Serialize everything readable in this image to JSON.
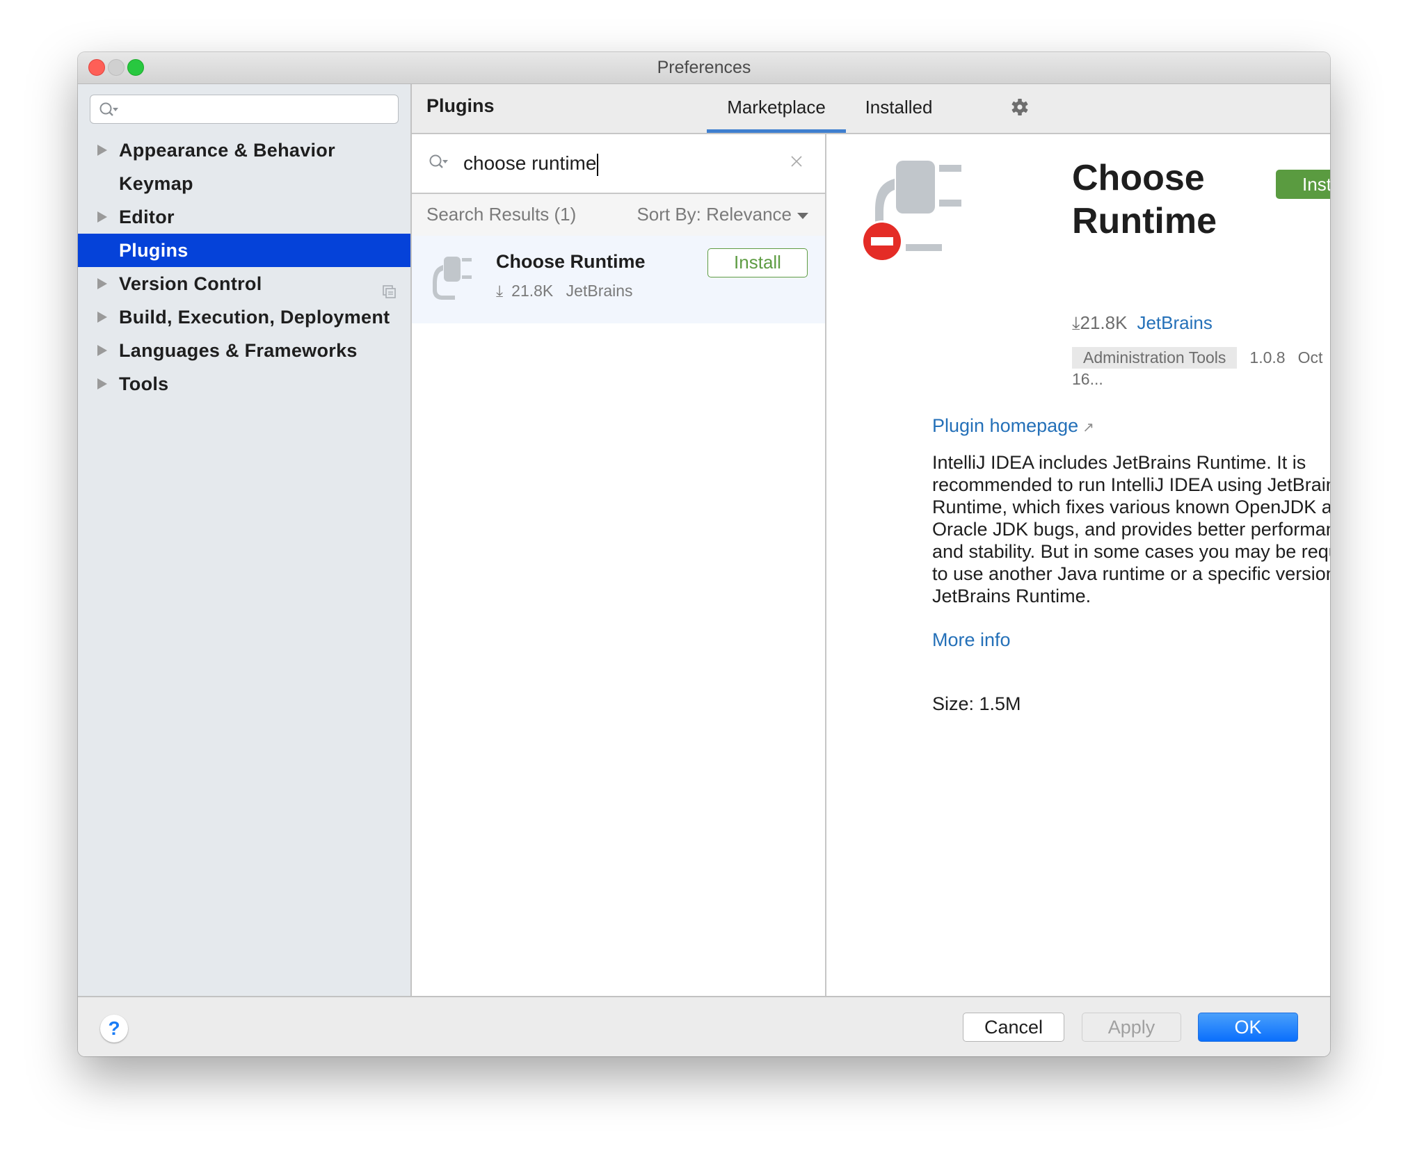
{
  "window": {
    "title": "Preferences"
  },
  "sidebar": {
    "search_placeholder": "",
    "items": [
      {
        "label": "Appearance & Behavior",
        "expandable": true,
        "selected": false
      },
      {
        "label": "Keymap",
        "expandable": false,
        "selected": false
      },
      {
        "label": "Editor",
        "expandable": true,
        "selected": false
      },
      {
        "label": "Plugins",
        "expandable": false,
        "selected": true
      },
      {
        "label": "Version Control",
        "expandable": true,
        "selected": false
      },
      {
        "label": "Build, Execution, Deployment",
        "expandable": true,
        "selected": false
      },
      {
        "label": "Languages & Frameworks",
        "expandable": true,
        "selected": false
      },
      {
        "label": "Tools",
        "expandable": true,
        "selected": false
      }
    ]
  },
  "plugins_header": {
    "title": "Plugins",
    "tabs": [
      {
        "label": "Marketplace",
        "active": true
      },
      {
        "label": "Installed",
        "active": false
      }
    ],
    "settings_icon": "gear-icon"
  },
  "search": {
    "query": "choose runtime",
    "results_label": "Search Results (1)",
    "sort_label": "Sort By: Relevance"
  },
  "results": [
    {
      "name": "Choose Runtime",
      "downloads": "21.8K",
      "vendor": "JetBrains",
      "install_label": "Install"
    }
  ],
  "detail": {
    "title": "Choose Runtime",
    "install_label": "Install",
    "downloads": "21.8K",
    "vendor": "JetBrains",
    "category": "Administration Tools",
    "version": "1.0.8",
    "date": "Oct 16...",
    "homepage_label": "Plugin homepage",
    "description": "IntelliJ IDEA includes JetBrains Runtime. It is recommended to run IntelliJ IDEA using JetBrains Runtime, which fixes various known OpenJDK and Oracle JDK bugs, and provides better performance and stability. But in some cases you may be required to use another Java runtime or a specific version of JetBrains Runtime.",
    "more_info_label": "More info",
    "size": "Size: 1.5M"
  },
  "footer": {
    "help_label": "?",
    "cancel_label": "Cancel",
    "apply_label": "Apply",
    "ok_label": "OK"
  },
  "colors": {
    "selection": "#0542d9",
    "install_green": "#5a9b40",
    "link_blue": "#2470b8",
    "tab_underline": "#3f7fcf",
    "ok_blue": "#0a6ffc"
  }
}
